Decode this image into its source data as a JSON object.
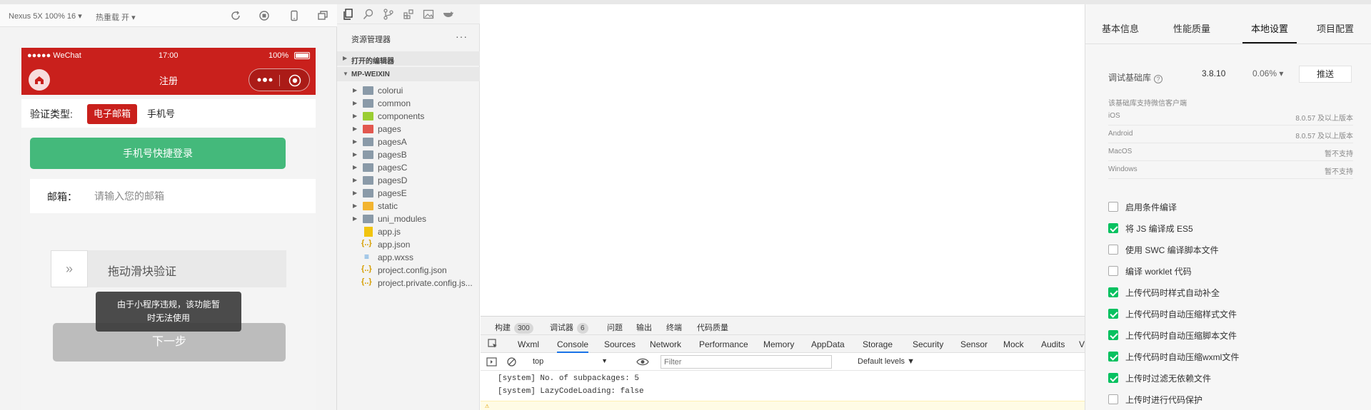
{
  "simulator": {
    "toolbar": {
      "device": "Nexus 5X 100% 16 ▾",
      "hot_reload": "热重载 开 ▾"
    },
    "statusbar": {
      "carrier": "●●●●● WeChat",
      "time": "17:00",
      "battery": "100%"
    },
    "nav_title": "注册",
    "verify_label": "验证类型:",
    "chip_email": "电子邮箱",
    "chip_phone": "手机号",
    "quick_login": "手机号快捷登录",
    "email_label": "邮箱：",
    "email_placeholder": "请输入您的邮箱",
    "slider_text": "拖动滑块验证",
    "slider_handle": "»",
    "next_button": "下一步",
    "toast_line1": "由于小程序违规，该功能暂",
    "toast_line2": "时无法使用"
  },
  "explorer": {
    "title": "资源管理器",
    "more": "···",
    "open_editors": "打开的编辑器",
    "project": "MP-WEIXIN",
    "items": [
      {
        "label": "colorui",
        "type": "folder"
      },
      {
        "label": "common",
        "type": "folder"
      },
      {
        "label": "components",
        "type": "folder"
      },
      {
        "label": "pages",
        "type": "folder"
      },
      {
        "label": "pagesA",
        "type": "folder"
      },
      {
        "label": "pagesB",
        "type": "folder"
      },
      {
        "label": "pagesC",
        "type": "folder"
      },
      {
        "label": "pagesD",
        "type": "folder"
      },
      {
        "label": "pagesE",
        "type": "folder"
      },
      {
        "label": "static",
        "type": "folder"
      },
      {
        "label": "uni_modules",
        "type": "folder"
      },
      {
        "label": "app.js",
        "type": "js"
      },
      {
        "label": "app.json",
        "type": "json"
      },
      {
        "label": "app.wxss",
        "type": "wxss"
      },
      {
        "label": "project.config.json",
        "type": "json"
      },
      {
        "label": "project.private.config.js...",
        "type": "json"
      }
    ]
  },
  "devtools": {
    "top_tabs": [
      {
        "label": "构建",
        "badge": "300"
      },
      {
        "label": "调试器",
        "badge": "6"
      },
      {
        "label": "问题",
        "badge": ""
      },
      {
        "label": "输出",
        "badge": ""
      },
      {
        "label": "终端",
        "badge": ""
      },
      {
        "label": "代码质量",
        "badge": ""
      }
    ],
    "tabs": [
      "Wxml",
      "Console",
      "Sources",
      "Network",
      "Performance",
      "Memory",
      "AppData",
      "Storage",
      "Security",
      "Sensor",
      "Mock",
      "Audits",
      "V"
    ],
    "active_tab": "Console",
    "context": "top",
    "filter_placeholder": "Filter",
    "levels": "Default levels ▼",
    "lines": [
      "[system] No. of subpackages: 5",
      "[system] LazyCodeLoading: false"
    ]
  },
  "settings": {
    "tabs": [
      "基本信息",
      "性能质量",
      "本地设置",
      "项目配置"
    ],
    "active_tab": "本地设置",
    "lib_label": "调试基础库",
    "lib_version": "3.8.10",
    "lib_percent": "0.06% ▾",
    "push": "推送",
    "support_title": "该基础库支持微信客户端",
    "support": [
      {
        "os": "iOS",
        "req": "8.0.57 及以上版本"
      },
      {
        "os": "Android",
        "req": "8.0.57 及以上版本"
      },
      {
        "os": "MacOS",
        "req": "暂不支持"
      },
      {
        "os": "Windows",
        "req": "暂不支持"
      }
    ],
    "options": [
      {
        "label": "启用条件编译",
        "checked": false
      },
      {
        "label": "将 JS 编译成 ES5",
        "checked": true
      },
      {
        "label": "使用 SWC 编译脚本文件",
        "checked": false
      },
      {
        "label": "编译 worklet 代码",
        "checked": false
      },
      {
        "label": "上传代码时样式自动补全",
        "checked": true
      },
      {
        "label": "上传代码时自动压缩样式文件",
        "checked": true
      },
      {
        "label": "上传代码时自动压缩脚本文件",
        "checked": true
      },
      {
        "label": "上传代码时自动压缩wxml文件",
        "checked": true
      },
      {
        "label": "上传时过滤无依赖文件",
        "checked": true
      },
      {
        "label": "上传时进行代码保护",
        "checked": false
      }
    ]
  },
  "colors": {
    "brand_red": "#c9201c",
    "green_button": "#44b97b",
    "check_green": "#07c160"
  }
}
